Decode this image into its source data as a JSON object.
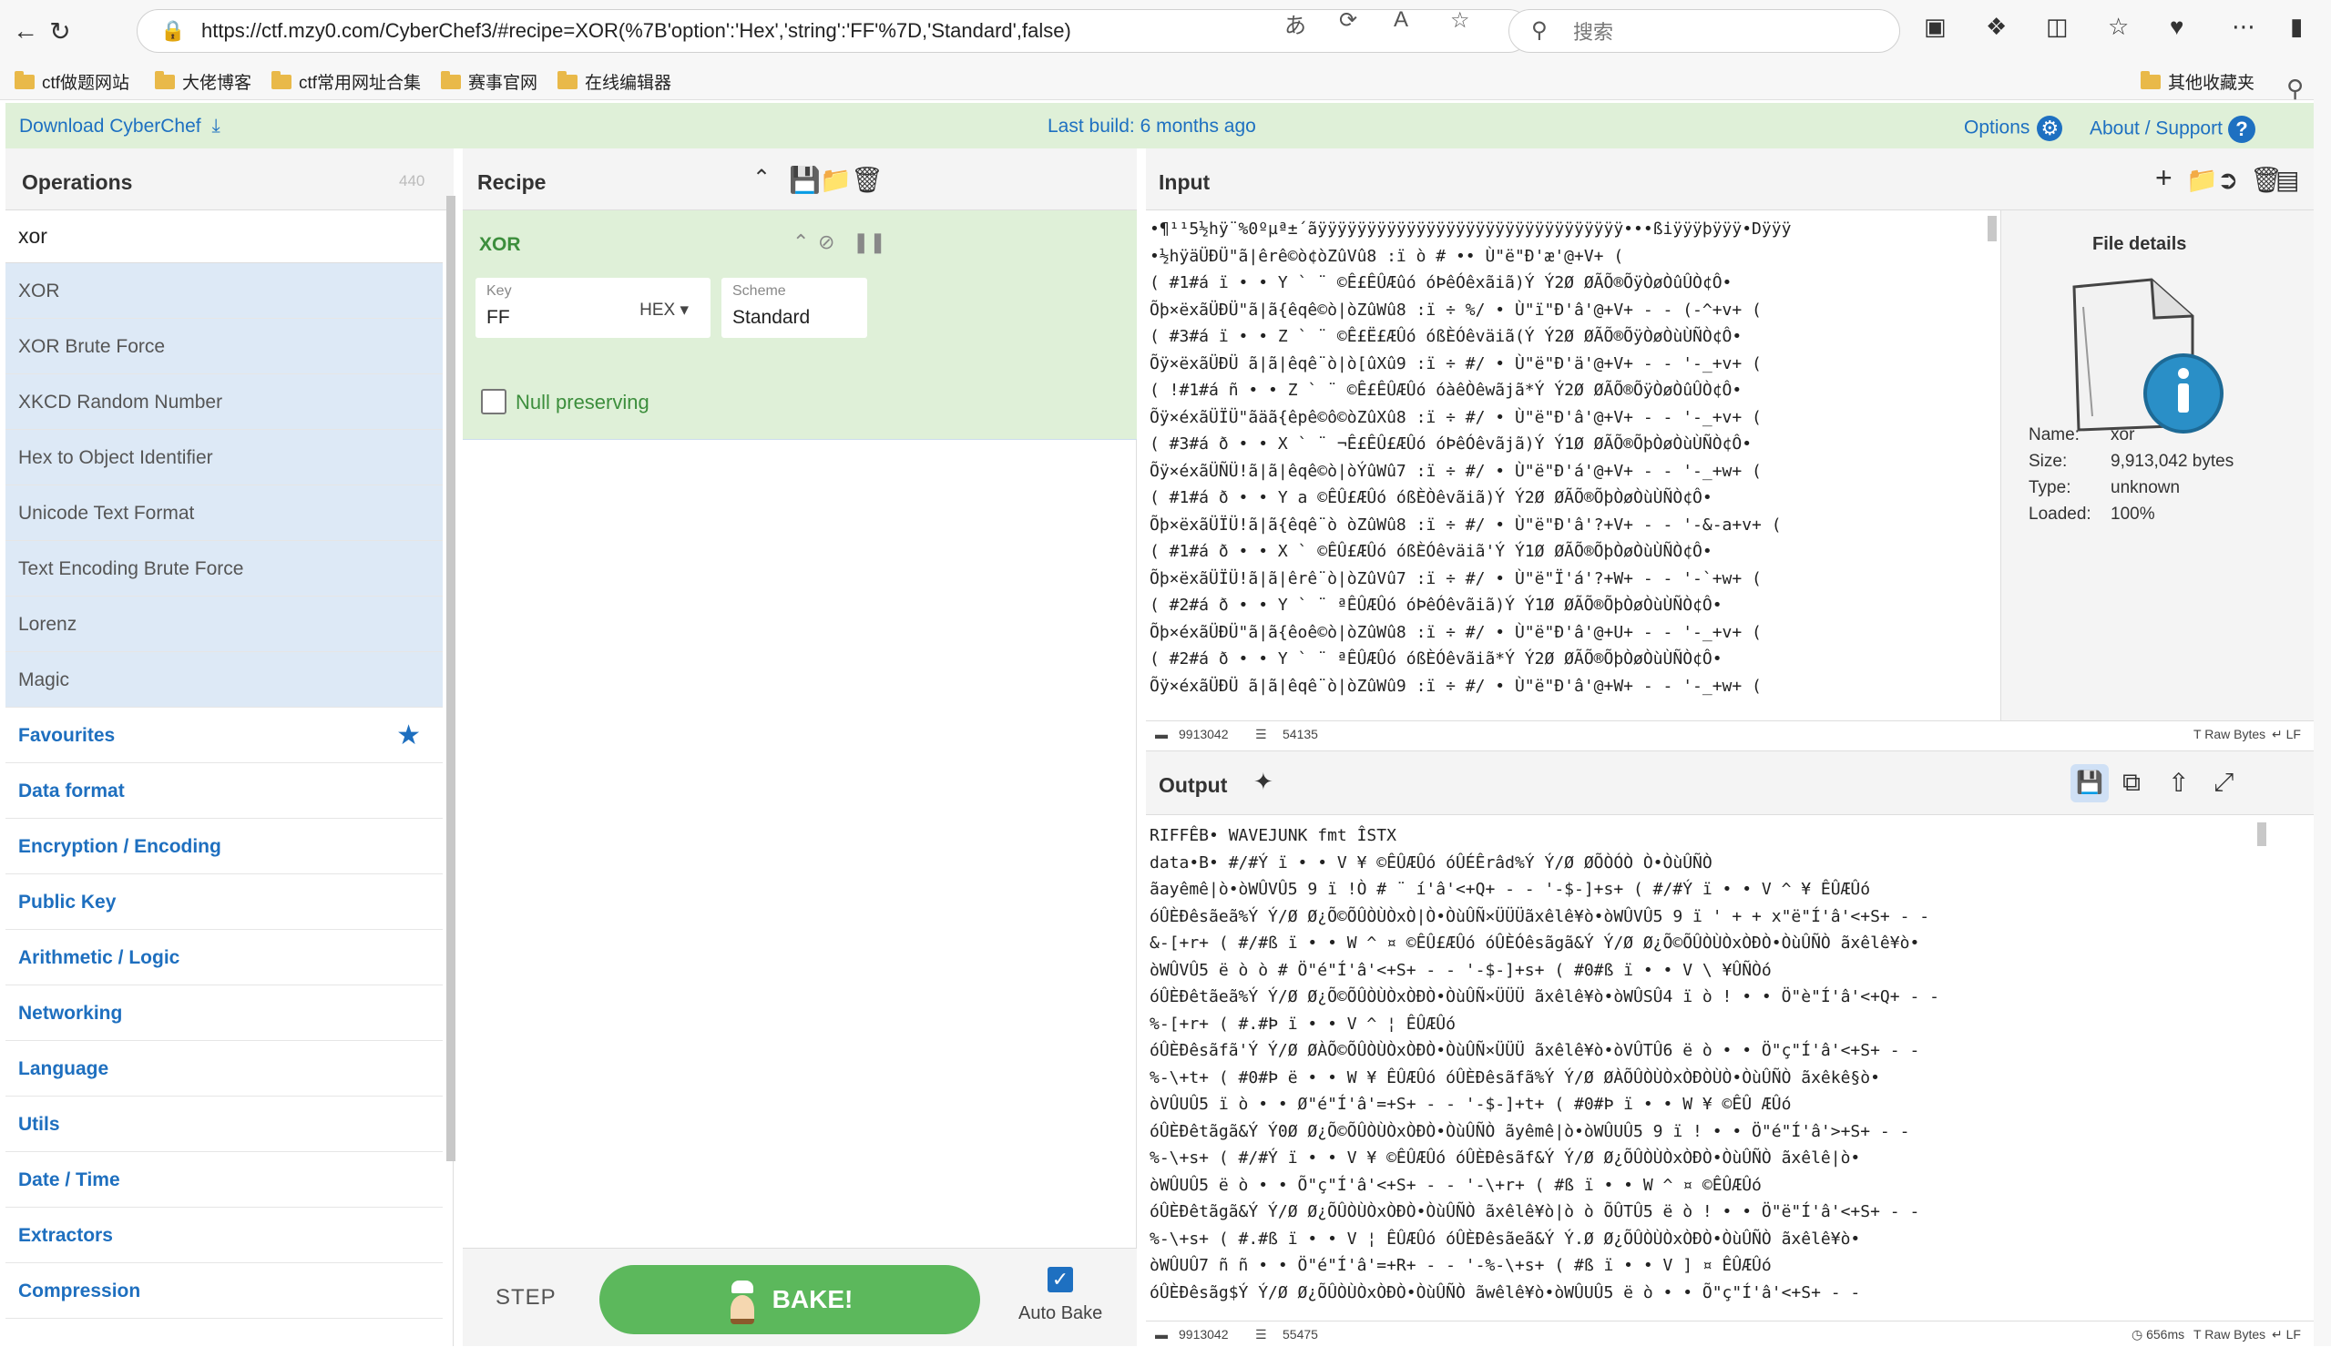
{
  "browser": {
    "url": "https://ctf.mzy0.com/CyberChef3/#recipe=XOR(%7B'option':'Hex','string':'FF'%7D,'Standard',false)",
    "search_placeholder": "搜索",
    "bookmarks": [
      "ctf做题网站",
      "大佬博客",
      "ctf常用网址合集",
      "赛事官网",
      "在线编辑器"
    ],
    "other_bookmarks": "其他收藏夹"
  },
  "banner": {
    "download": "Download CyberChef",
    "last_build": "Last build: 6 months ago",
    "options": "Options",
    "about": "About / Support"
  },
  "operations": {
    "title": "Operations",
    "count": "440",
    "search_value": "xor",
    "results": [
      {
        "pre": "",
        "hl": "XOR",
        "post": ""
      },
      {
        "pre": "",
        "hl": "XOR",
        "post": " Brute Force"
      },
      {
        "pre": "",
        "hl": "X",
        "post": "KCD Random Number"
      },
      {
        "pre": "He",
        "hl": "x",
        "post": " to Object Identifier"
      },
      {
        "pre": "Unicode Te",
        "hl": "x",
        "post": "t Format"
      },
      {
        "pre": "Te",
        "hl": "x",
        "post": "t Encoding Brute Force"
      },
      {
        "pre": "Lorenz",
        "hl": "",
        "post": ""
      },
      {
        "pre": "Magic",
        "hl": "",
        "post": ""
      }
    ],
    "categories": [
      "Favourites",
      "Data format",
      "Encryption / Encoding",
      "Public Key",
      "Arithmetic / Logic",
      "Networking",
      "Language",
      "Utils",
      "Date / Time",
      "Extractors",
      "Compression"
    ]
  },
  "recipe": {
    "title": "Recipe",
    "op_name": "XOR",
    "key_label": "Key",
    "key_value": "FF",
    "key_format": "HEX",
    "scheme_label": "Scheme",
    "scheme_value": "Standard",
    "null_preserving": "Null preserving",
    "step": "STEP",
    "bake": "BAKE!",
    "auto_bake": "Auto Bake"
  },
  "input": {
    "title": "Input",
    "lines": [
      "•¶¹¹5½hÿ¨%0ºµª±´ãÿÿÿÿÿÿÿÿÿÿÿÿÿÿÿÿÿÿÿÿÿÿÿÿÿÿÿÿÿÿÿ•••ßiÿÿÿþÿÿÿ•Dÿÿÿ",
      "•½hÿäÜÐÜ\"ã|êrê©ò¢òZûVû8 :ï ò # •• Ù\"ë\"Ð'æ'@+V+ ( ",
      "( #1#á ï • • Y ` ¨ ©Ê£ÊÛÆûó óÞêÓêxãiã)Ý Ý2Ø ØÃÕ®ÕÿÒøÒûÛÒ¢Ô•",
      "Õþ×ëxãÜÐÜ\"ã|ã{êqê©ò|òZûWû8 :ï ÷ %/ • Ù\"ï\"Ð'â'@+V+ - - (-^+v+ (",
      "( #3#á ï • • Z ` ¨ ©Ê£Ë£ÆÛó óßÈÓêväiã(Ý Ý2Ø ØÃÕ®ÕÿÒøÒùÙÑÒ¢Ô•",
      "Õÿ×ëxãÜÐÜ ã|ã|êqê¨ò|ò[ûXû9 :ï ÷ #/ • Ù\"ë\"Ð'ä'@+V+ - - '-_+v+ (",
      "( !#1#á ñ • • Z ` ¨ ©Ê£ÊÛÆÛó óàêÒêwãjã*Ý Ý2Ø ØÃÕ®ÕÿÒøÒûÛÒ¢Ô•",
      "Õÿ×éxãÜÏÜ\"ãäã{êpê©ô©òZûXû8 :ï ÷ #/ • Ù\"ë\"Ð'â'@+V+ - - '-_+v+ (",
      "( #3#á ð • • X ` ¨ ¬Ê£ÊÛ£ÆÛó óÞêÓêvãjã)Ý Ý1Ø ØÃÕ®ÕþÒøÒùÙÑÒ¢Ô•",
      "Õÿ×éxãÜÑÜ!ã|ã|êqê©ò|òÝûWû7 :ï ÷ #/ • Ù\"ë\"Ð'á'@+V+ - - '-_+w+ (",
      "( #1#á ð • • Y a ©ÊÛ£ÆÛó óßÈÒêvãiã)Ý Ý2Ø ØÃÕ®ÕþÒøÒùÙÑÒ¢Ô•",
      "Õþ×ëxãÜÏÜ!ã|ã{êqê¨ò òZûWû8 :ï ÷ #/ • Ù\"ë\"Ð'â'?+V+ - - '-&-a+v+ (",
      "( #1#á ð • • X ` ©ÊÛ£ÆÛó óßÈÓêväiã'Ý Ý1Ø ØÃÕ®ÕþÒøÒùÙÑÒ¢Ô•",
      "Õþ×ëxãÜÏÜ!ã|ã|êrê¨ò|òZûVû7 :ï ÷ #/ • Ù\"ë\"Ï'á'?+W+ - - '-`+w+ (",
      "( #2#á ð • • Y ` ¨ ªÊÛÆÛó óÞêÓêvãiã)Ý Ý1Ø ØÃÕ®ÕþÒøÒùÙÑÒ¢Ô•",
      "Õþ×éxãÜÐÜ\"ã|ã{êoê©ò|òZûWû8 :ï ÷ #/ • Ù\"ë\"Ð'â'@+U+ - - '-_+v+ (",
      "( #2#á ð • • Y ` ¨ ªÊÛÆÛó óßÈÓêvãiã*Ý Ý2Ø ØÃÕ®ÕþÒøÒùÙÑÒ¢Ô•",
      "Õÿ×éxãÜÐÜ ã|ã|êqê¨ò|òZûWû9 :ï ÷ #/ • Ù\"ë\"Ð'â'@+W+ - - '-_+w+ ("
    ],
    "file_details_title": "File details",
    "file_details": [
      {
        "label": "Name:",
        "value": "xor"
      },
      {
        "label": "Size:",
        "value": "9,913,042 bytes"
      },
      {
        "label": "Type:",
        "value": "unknown"
      },
      {
        "label": "Loaded:",
        "value": "100%"
      }
    ],
    "status_length": "9913042",
    "status_lines": "54135",
    "status_encoding": "Raw Bytes",
    "status_eol": "LF"
  },
  "output": {
    "title": "Output",
    "lines": [
      "RIFFÊB• WAVEJUNK fmt ÎSTX",
      "data•B• #/#Ý ï • • V ¥ ©ÊÛÆÛó óÛÉÊrâd%Ý Ý/Ø ØÕÒÓÒ Ò•ÒùÛÑÒ",
      "ãayêmê|ò•òWÛVÛ5 9 ï !Ò # ¨ í'â'<+Q+ - - '-$-]+s+ ( #/#Ý ï • • V ^ ¥ ÊÛÆÛó",
      "óÛÈÐêsãeã%Ý Ý/Ø Ø¿Õ©ÕÛÒÙÒxÒ|Ò•ÒùÛÑ×ÜÜÜãxêlê¥ò•òWÛVÛ5 9 ï ' + + x\"ë\"Í'â'<+S+ - -",
      "&-[+r+ ( #/#ß ï • • W ^ ¤ ©ÊÛ£ÆÛó óÛÈÓêsãgã&Ý Ý/Ø Ø¿Õ©ÕÛÒÙÒxÒÐÒ•ÒùÛÑÒ ãxêlê¥ò•",
      "òWÛVÛ5 ë ò ò # Ö\"é\"Í'â'<+S+ - - '-$-]+s+ ( #0#ß ï • • V \\ ¥ÛÑÒó",
      "óÛÈÐêtãeã%Ý Ý/Ø Ø¿Õ©ÕÛÒÙÒxÒÐÒ•ÒùÛÑ×ÜÜÜ ãxêlê¥ò•òWÛSÛ4 ï ò ! • • Ö\"è\"Í'â'<+Q+ - -",
      "%-[+r+ ( #.#Þ ï • • V ^ ¦ ÊÛÆÛó",
      "óÛÈÐêsãfã'Ý Ý/Ø ØÀÕ©ÕÛÒÙÒxÒÐÒ•ÒùÛÑ×ÜÜÜ ãxêlê¥ò•òVÛTÛ6 ë ò • • Ö\"ç\"Í'â'<+S+ - -",
      "%-\\+t+ ( #0#Þ ë • • W ¥ ÊÛÆÛó óÛÈÐêsãfã%Ý Ý/Ø ØÀÕÛÒÙÒxÒÐÒÙÒ•ÒùÛÑÒ ãxêkê§ò•",
      "òVÛUÛ5 ï ò • • Ø\"é\"Í'â'=+S+ - - '-$-]+t+ ( #0#Þ ï • • W ¥ ©ÊÛ ÆÛó",
      "óÛÈÐêtãgã&Ý Ý0Ø Ø¿Õ©ÕÛÒÙÒxÒÐÒ•ÒùÛÑÒ ãyêmê|ò•òWÛUÛ5 9 ï ! • • Ö\"é\"Í'â'>+S+ - -",
      "%-\\+s+ ( #/#Ý ï • • V ¥ ©ÊÛÆÛó óÛÈÐêsãf&Ý Ý/Ø Ø¿ÕÛÒÙÒxÒÐÒ•ÒùÛÑÒ ãxêlê|ò•",
      "òWÛUÛ5 ë ò • • Õ\"ç\"Í'â'<+S+ - - '-\\+r+ ( #ß ï • • W ^ ¤ ©ÊÛÆÛó",
      "óÛÈÐêtãgã&Ý Ý/Ø Ø¿ÕÛÒÙÒxÒÐÒ•ÒùÛÑÒ ãxêlê¥ò|ò ò ÕÛTÛ5 ë ò ! • • Ö\"ë\"Í'â'<+S+ - -",
      "%-\\+s+ ( #.#ß ï • • V ¦ ÊÛÆÛó óÛÈÐêsãeã&Ý Ý.Ø Ø¿ÕÛÒÙÒxÒÐÒ•ÒùÛÑÒ ãxêlê¥ò•",
      "òWÛUÛ7 ñ ñ • • Ö\"é\"Í'â'=+R+ - - '-%-\\+s+ ( #ß ï • • V ] ¤ ÊÛÆÛó",
      "óÛÈÐêsãg$Ý Ý/Ø Ø¿ÕÛÒÙÒxÒÐÒ•ÒùÛÑÒ ãwêlê¥ò•òWÛUÛ5 ë ò • • Õ\"ç\"Í'â'<+S+ - -"
    ],
    "status_length": "9913042",
    "status_lines": "55475",
    "status_time": "656ms",
    "status_encoding": "Raw Bytes",
    "status_eol": "LF"
  },
  "icons": {
    "back": "arrow-left-icon",
    "reload": "reload-icon",
    "lock": "lock-icon",
    "search": "search-icon",
    "gear": "gear-icon",
    "help": "question-icon",
    "download": "download-icon",
    "save": "save-icon",
    "folder": "folder-icon",
    "trash": "trash-icon",
    "add": "plus-icon",
    "wand": "magic-wand-icon",
    "copy": "copy-icon",
    "expand": "expand-icon",
    "star": "star-icon"
  },
  "colors": {
    "accent": "#1e70c1",
    "banner_bg": "#dff0d8",
    "op_bg": "#dde9f6",
    "bake": "#5cb85c",
    "control_char": "#dd2222"
  }
}
